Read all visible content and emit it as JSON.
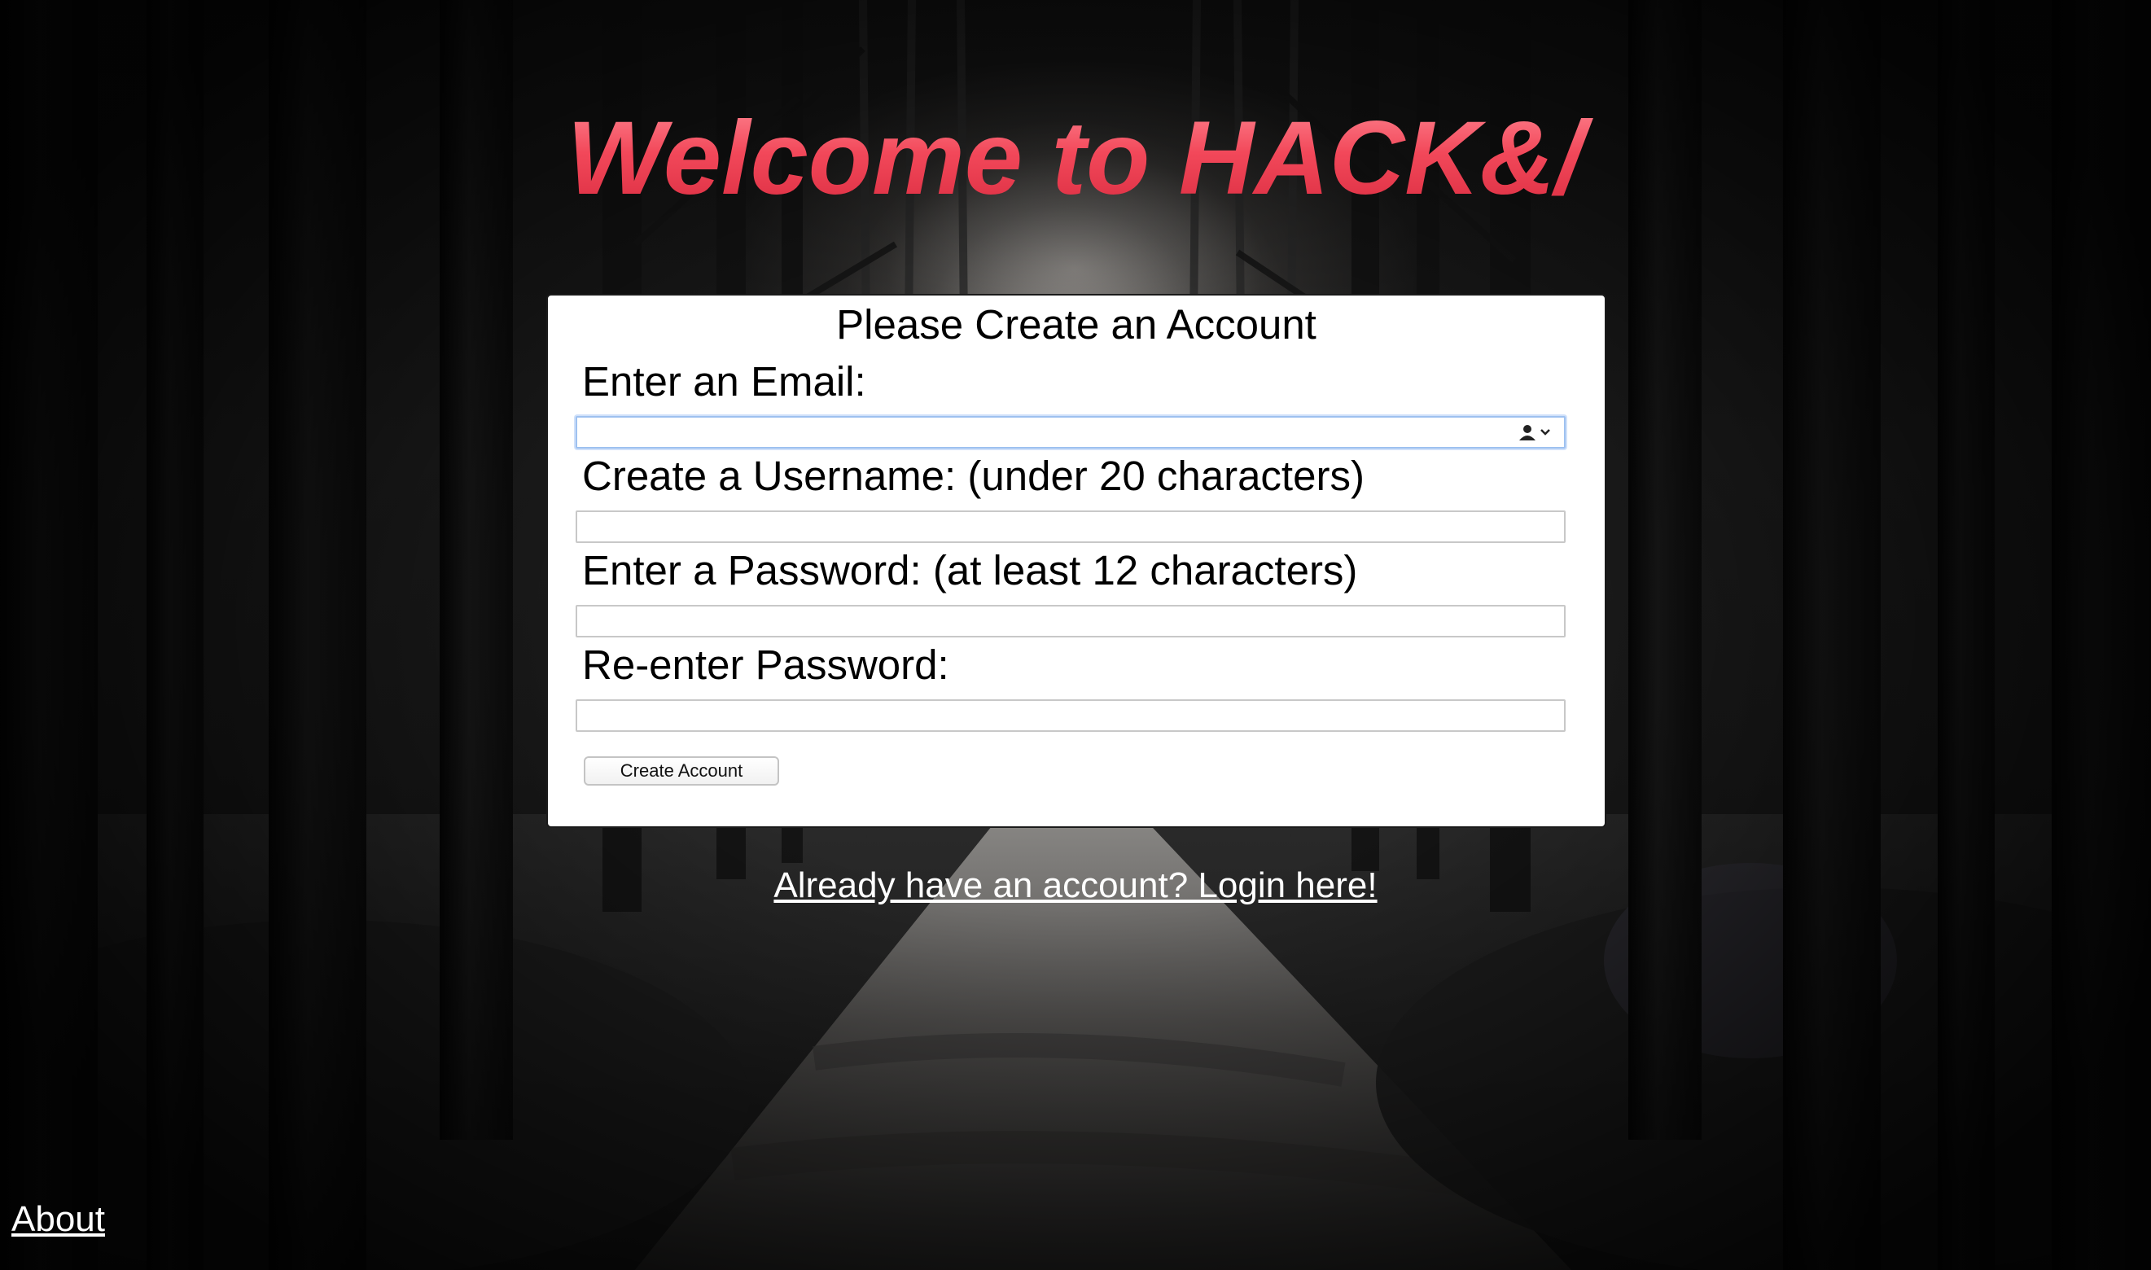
{
  "page": {
    "headline": "Welcome to HACK&/",
    "background": "dark forest road"
  },
  "form": {
    "title": "Please Create an Account",
    "email": {
      "label": "Enter an Email:",
      "value": "",
      "placeholder": ""
    },
    "username": {
      "label": "Create a Username: (under 20 characters)",
      "value": "",
      "placeholder": ""
    },
    "password": {
      "label": "Enter a Password: (at least 12 characters)",
      "value": "",
      "placeholder": ""
    },
    "confirm_password": {
      "label": "Re-enter Password:",
      "value": "",
      "placeholder": ""
    },
    "submit_label": "Create Account"
  },
  "links": {
    "login": "Already have an account? Login here!",
    "about": "About"
  },
  "icons": {
    "email_autofill": "contact-autofill-icon"
  },
  "colors": {
    "headline": "#f04a5c",
    "card": "#ffffff",
    "link": "#ffffff",
    "focus_ring": "#9ec1f0"
  }
}
